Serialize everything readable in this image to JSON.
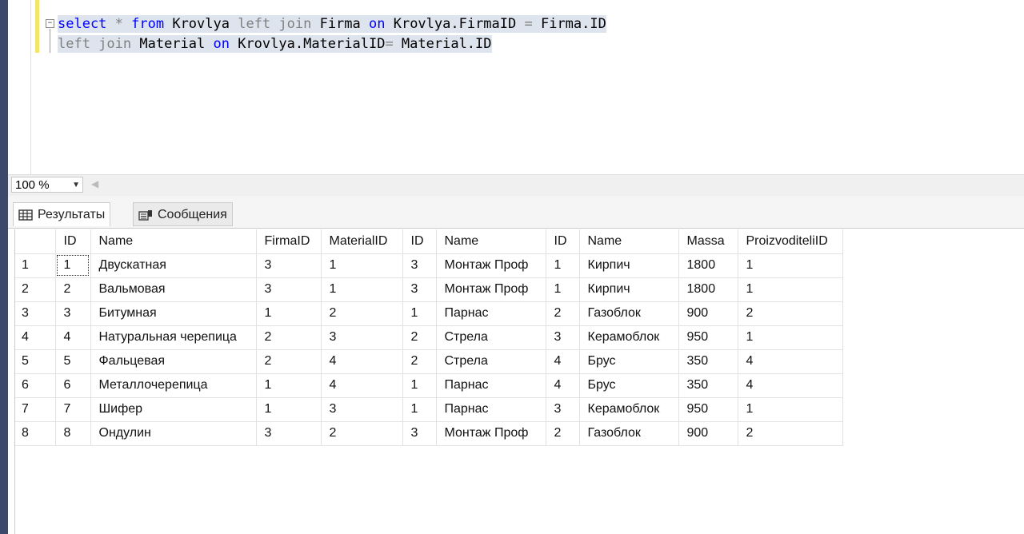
{
  "editor": {
    "line1": [
      {
        "t": "select",
        "c": "kw"
      },
      {
        "t": " * ",
        "c": "op"
      },
      {
        "t": "from",
        "c": "kw"
      },
      {
        "t": " Krovlya ",
        "c": "id"
      },
      {
        "t": "left join",
        "c": "gray"
      },
      {
        "t": " Firma ",
        "c": "id"
      },
      {
        "t": "on",
        "c": "kw"
      },
      {
        "t": " Krovlya.FirmaID ",
        "c": "id"
      },
      {
        "t": "=",
        "c": "op"
      },
      {
        "t": " Firma.ID",
        "c": "id"
      }
    ],
    "line2": [
      {
        "t": "left join",
        "c": "gray"
      },
      {
        "t": " Material ",
        "c": "id"
      },
      {
        "t": "on",
        "c": "kw"
      },
      {
        "t": " Krovlya.MaterialID",
        "c": "id"
      },
      {
        "t": "=",
        "c": "op"
      },
      {
        "t": " Material.ID",
        "c": "id"
      }
    ],
    "fold_symbol": "−"
  },
  "zoom": {
    "value": "100 %",
    "arrow": "▼",
    "scroll_arrow": "◀"
  },
  "tabs": [
    {
      "label": "Результаты",
      "icon": "grid-icon"
    },
    {
      "label": "Сообщения",
      "icon": "messages-icon"
    }
  ],
  "results": {
    "columns": [
      "",
      "ID",
      "Name",
      "FirmaID",
      "MaterialID",
      "ID",
      "Name",
      "ID",
      "Name",
      "Massa",
      "ProizvoditeliID"
    ],
    "rows": [
      [
        "1",
        "1",
        "Двускатная",
        "3",
        "1",
        "3",
        "Монтаж Проф",
        "1",
        "Кирпич",
        "1800",
        "1"
      ],
      [
        "2",
        "2",
        "Вальмовая",
        "3",
        "1",
        "3",
        "Монтаж Проф",
        "1",
        "Кирпич",
        "1800",
        "1"
      ],
      [
        "3",
        "3",
        "Битумная",
        "1",
        "2",
        "1",
        "Парнас",
        "2",
        "Газоблок",
        "900",
        "2"
      ],
      [
        "4",
        "4",
        "Натуральная черепица",
        "2",
        "3",
        "2",
        "Стрела",
        "3",
        "Керамоблок",
        "950",
        "1"
      ],
      [
        "5",
        "5",
        "Фальцевая",
        "2",
        "4",
        "2",
        "Стрела",
        "4",
        "Брус",
        "350",
        "4"
      ],
      [
        "6",
        "6",
        "Металлочерепица",
        "1",
        "4",
        "1",
        "Парнас",
        "4",
        "Брус",
        "350",
        "4"
      ],
      [
        "7",
        "7",
        "Шифер",
        "1",
        "3",
        "1",
        "Парнас",
        "3",
        "Керамоблок",
        "950",
        "1"
      ],
      [
        "8",
        "8",
        "Ондулин",
        "3",
        "2",
        "3",
        "Монтаж Проф",
        "2",
        "Газоблок",
        "900",
        "2"
      ]
    ]
  }
}
